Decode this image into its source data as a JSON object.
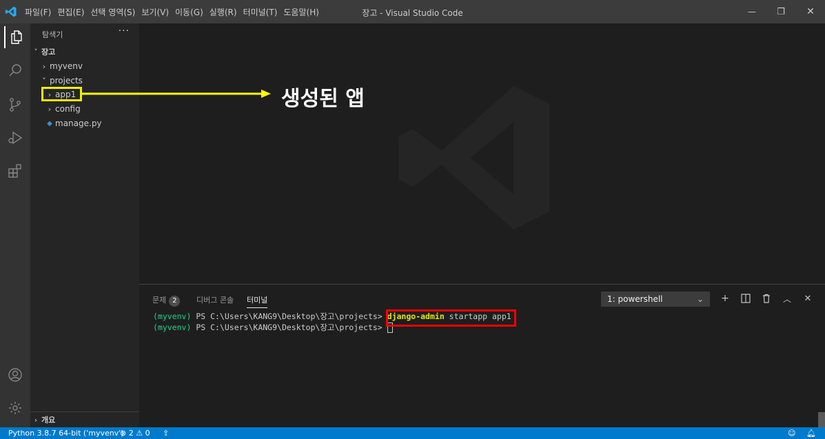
{
  "window": {
    "title": "장고 - Visual Studio Code",
    "menu": [
      "파일(F)",
      "편집(E)",
      "선택 영역(S)",
      "보기(V)",
      "이동(G)",
      "실행(R)",
      "터미널(T)",
      "도움말(H)"
    ],
    "controls": {
      "minimize_icon": "—",
      "restore_icon": "❐",
      "close_icon": "✕"
    }
  },
  "sidebar": {
    "title": "탐색기",
    "more": "···",
    "root": "장고",
    "tree": [
      {
        "label": "myvenv",
        "chevron": "›"
      },
      {
        "label": "projects",
        "chevron": "˅"
      },
      {
        "label": "app1",
        "chevron": "›"
      },
      {
        "label": "config",
        "chevron": "›"
      },
      {
        "label": "manage.py",
        "chevron": ""
      }
    ],
    "outline": "개요"
  },
  "annotation": {
    "label": "생성된 앱",
    "arrow_color": "#ffff00"
  },
  "panel": {
    "tabs": [
      {
        "label": "문제",
        "badge": "2"
      },
      {
        "label": "디버그 콘솔"
      },
      {
        "label": "터미널"
      }
    ],
    "terminal_select": "1: powershell",
    "terminal_lines": [
      {
        "venv": "(myvenv)",
        "prompt": " PS C:\\Users\\KANG9\\Desktop\\장고\\projects> ",
        "command": "django-admin",
        "args": " startapp app1"
      },
      {
        "venv": "(myvenv)",
        "prompt": " PS C:\\Users\\KANG9\\Desktop\\장고\\projects> "
      }
    ]
  },
  "status": {
    "python": "Python 3.8.7 64-bit ('myvenv')",
    "errors": "2",
    "warnings": "0"
  },
  "colors": {
    "statusbar": "#007acc",
    "highlight_red": "#ff0000",
    "highlight_yellow": "#f0f000"
  }
}
